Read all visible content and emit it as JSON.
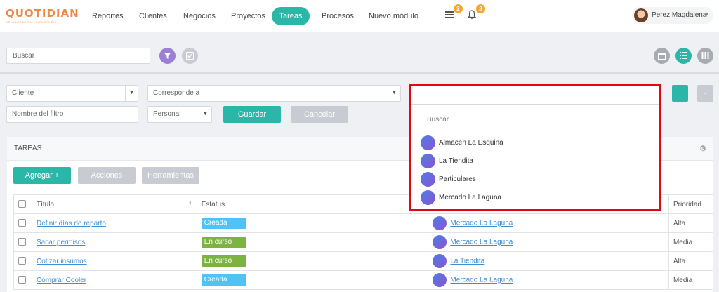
{
  "brand": {
    "logo": "QUOTIDIAN",
    "tagline": "COLABORACIÓN FÁCIL DÍA DÍA"
  },
  "nav": {
    "items": [
      "Reportes",
      "Clientes",
      "Negocios",
      "Proyectos",
      "Tareas",
      "Procesos",
      "Nuevo módulo"
    ],
    "active": "Tareas",
    "list_badge": "2",
    "bell_badge": "3"
  },
  "user": {
    "name": "Perez Magdalena"
  },
  "search": {
    "placeholder": "Buscar"
  },
  "filters": {
    "cliente": "Cliente",
    "corresponde": "Corresponde a",
    "filter_name": "Nombre del filtro",
    "personal": "Personal",
    "save": "Guardar",
    "cancel": "Cancelar",
    "plus": "+",
    "minus": "-"
  },
  "panel": {
    "title": "TAREAS",
    "add": "Agregar +",
    "actions": "Acciones",
    "tools": "Herramientas",
    "columns": {
      "title": "Título",
      "status": "Estatus",
      "priority": "Prioridad"
    },
    "rows": [
      {
        "title": "Definir días de reparto",
        "status": "Creada",
        "status_color": "#4fc3f7",
        "client": "Mercado La Laguna",
        "priority": "Alta"
      },
      {
        "title": "Sacar permisos",
        "status": "En curso",
        "status_color": "#7cb342",
        "client": "Mercado La Laguna",
        "priority": "Media"
      },
      {
        "title": "Cotizar insumos",
        "status": "En curso",
        "status_color": "#7cb342",
        "client": "La Tiendita",
        "priority": "Alta"
      },
      {
        "title": "Comprar Cooler",
        "status": "Creada",
        "status_color": "#4fc3f7",
        "client": "Mercado La Laguna",
        "priority": "Media"
      }
    ]
  },
  "dropdown": {
    "search_placeholder": "Buscar",
    "options": [
      "Almacén La Esquina",
      "La Tiendita",
      "Particulares",
      "Mercado La Laguna"
    ]
  },
  "colors": {
    "accent": "#2bb7a8",
    "filter_btn": "#9b7fd4",
    "highlight": "#e30613"
  }
}
